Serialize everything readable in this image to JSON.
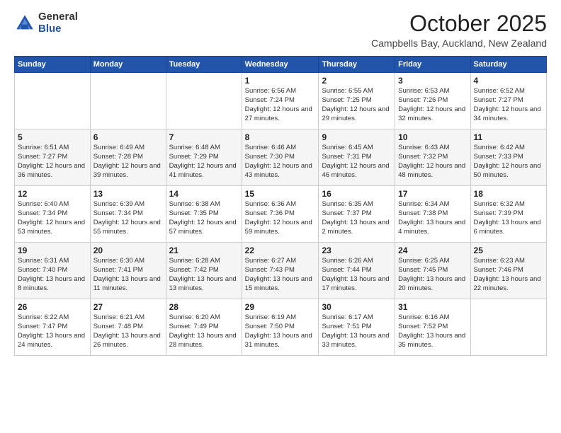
{
  "logo": {
    "general": "General",
    "blue": "Blue"
  },
  "title": {
    "month": "October 2025",
    "location": "Campbells Bay, Auckland, New Zealand"
  },
  "headers": [
    "Sunday",
    "Monday",
    "Tuesday",
    "Wednesday",
    "Thursday",
    "Friday",
    "Saturday"
  ],
  "weeks": [
    [
      {
        "day": "",
        "sunrise": "",
        "sunset": "",
        "daylight": ""
      },
      {
        "day": "",
        "sunrise": "",
        "sunset": "",
        "daylight": ""
      },
      {
        "day": "",
        "sunrise": "",
        "sunset": "",
        "daylight": ""
      },
      {
        "day": "1",
        "sunrise": "Sunrise: 6:56 AM",
        "sunset": "Sunset: 7:24 PM",
        "daylight": "Daylight: 12 hours and 27 minutes."
      },
      {
        "day": "2",
        "sunrise": "Sunrise: 6:55 AM",
        "sunset": "Sunset: 7:25 PM",
        "daylight": "Daylight: 12 hours and 29 minutes."
      },
      {
        "day": "3",
        "sunrise": "Sunrise: 6:53 AM",
        "sunset": "Sunset: 7:26 PM",
        "daylight": "Daylight: 12 hours and 32 minutes."
      },
      {
        "day": "4",
        "sunrise": "Sunrise: 6:52 AM",
        "sunset": "Sunset: 7:27 PM",
        "daylight": "Daylight: 12 hours and 34 minutes."
      }
    ],
    [
      {
        "day": "5",
        "sunrise": "Sunrise: 6:51 AM",
        "sunset": "Sunset: 7:27 PM",
        "daylight": "Daylight: 12 hours and 36 minutes."
      },
      {
        "day": "6",
        "sunrise": "Sunrise: 6:49 AM",
        "sunset": "Sunset: 7:28 PM",
        "daylight": "Daylight: 12 hours and 39 minutes."
      },
      {
        "day": "7",
        "sunrise": "Sunrise: 6:48 AM",
        "sunset": "Sunset: 7:29 PM",
        "daylight": "Daylight: 12 hours and 41 minutes."
      },
      {
        "day": "8",
        "sunrise": "Sunrise: 6:46 AM",
        "sunset": "Sunset: 7:30 PM",
        "daylight": "Daylight: 12 hours and 43 minutes."
      },
      {
        "day": "9",
        "sunrise": "Sunrise: 6:45 AM",
        "sunset": "Sunset: 7:31 PM",
        "daylight": "Daylight: 12 hours and 46 minutes."
      },
      {
        "day": "10",
        "sunrise": "Sunrise: 6:43 AM",
        "sunset": "Sunset: 7:32 PM",
        "daylight": "Daylight: 12 hours and 48 minutes."
      },
      {
        "day": "11",
        "sunrise": "Sunrise: 6:42 AM",
        "sunset": "Sunset: 7:33 PM",
        "daylight": "Daylight: 12 hours and 50 minutes."
      }
    ],
    [
      {
        "day": "12",
        "sunrise": "Sunrise: 6:40 AM",
        "sunset": "Sunset: 7:34 PM",
        "daylight": "Daylight: 12 hours and 53 minutes."
      },
      {
        "day": "13",
        "sunrise": "Sunrise: 6:39 AM",
        "sunset": "Sunset: 7:34 PM",
        "daylight": "Daylight: 12 hours and 55 minutes."
      },
      {
        "day": "14",
        "sunrise": "Sunrise: 6:38 AM",
        "sunset": "Sunset: 7:35 PM",
        "daylight": "Daylight: 12 hours and 57 minutes."
      },
      {
        "day": "15",
        "sunrise": "Sunrise: 6:36 AM",
        "sunset": "Sunset: 7:36 PM",
        "daylight": "Daylight: 12 hours and 59 minutes."
      },
      {
        "day": "16",
        "sunrise": "Sunrise: 6:35 AM",
        "sunset": "Sunset: 7:37 PM",
        "daylight": "Daylight: 13 hours and 2 minutes."
      },
      {
        "day": "17",
        "sunrise": "Sunrise: 6:34 AM",
        "sunset": "Sunset: 7:38 PM",
        "daylight": "Daylight: 13 hours and 4 minutes."
      },
      {
        "day": "18",
        "sunrise": "Sunrise: 6:32 AM",
        "sunset": "Sunset: 7:39 PM",
        "daylight": "Daylight: 13 hours and 6 minutes."
      }
    ],
    [
      {
        "day": "19",
        "sunrise": "Sunrise: 6:31 AM",
        "sunset": "Sunset: 7:40 PM",
        "daylight": "Daylight: 13 hours and 8 minutes."
      },
      {
        "day": "20",
        "sunrise": "Sunrise: 6:30 AM",
        "sunset": "Sunset: 7:41 PM",
        "daylight": "Daylight: 13 hours and 11 minutes."
      },
      {
        "day": "21",
        "sunrise": "Sunrise: 6:28 AM",
        "sunset": "Sunset: 7:42 PM",
        "daylight": "Daylight: 13 hours and 13 minutes."
      },
      {
        "day": "22",
        "sunrise": "Sunrise: 6:27 AM",
        "sunset": "Sunset: 7:43 PM",
        "daylight": "Daylight: 13 hours and 15 minutes."
      },
      {
        "day": "23",
        "sunrise": "Sunrise: 6:26 AM",
        "sunset": "Sunset: 7:44 PM",
        "daylight": "Daylight: 13 hours and 17 minutes."
      },
      {
        "day": "24",
        "sunrise": "Sunrise: 6:25 AM",
        "sunset": "Sunset: 7:45 PM",
        "daylight": "Daylight: 13 hours and 20 minutes."
      },
      {
        "day": "25",
        "sunrise": "Sunrise: 6:23 AM",
        "sunset": "Sunset: 7:46 PM",
        "daylight": "Daylight: 13 hours and 22 minutes."
      }
    ],
    [
      {
        "day": "26",
        "sunrise": "Sunrise: 6:22 AM",
        "sunset": "Sunset: 7:47 PM",
        "daylight": "Daylight: 13 hours and 24 minutes."
      },
      {
        "day": "27",
        "sunrise": "Sunrise: 6:21 AM",
        "sunset": "Sunset: 7:48 PM",
        "daylight": "Daylight: 13 hours and 26 minutes."
      },
      {
        "day": "28",
        "sunrise": "Sunrise: 6:20 AM",
        "sunset": "Sunset: 7:49 PM",
        "daylight": "Daylight: 13 hours and 28 minutes."
      },
      {
        "day": "29",
        "sunrise": "Sunrise: 6:19 AM",
        "sunset": "Sunset: 7:50 PM",
        "daylight": "Daylight: 13 hours and 31 minutes."
      },
      {
        "day": "30",
        "sunrise": "Sunrise: 6:17 AM",
        "sunset": "Sunset: 7:51 PM",
        "daylight": "Daylight: 13 hours and 33 minutes."
      },
      {
        "day": "31",
        "sunrise": "Sunrise: 6:16 AM",
        "sunset": "Sunset: 7:52 PM",
        "daylight": "Daylight: 13 hours and 35 minutes."
      },
      {
        "day": "",
        "sunrise": "",
        "sunset": "",
        "daylight": ""
      }
    ]
  ]
}
